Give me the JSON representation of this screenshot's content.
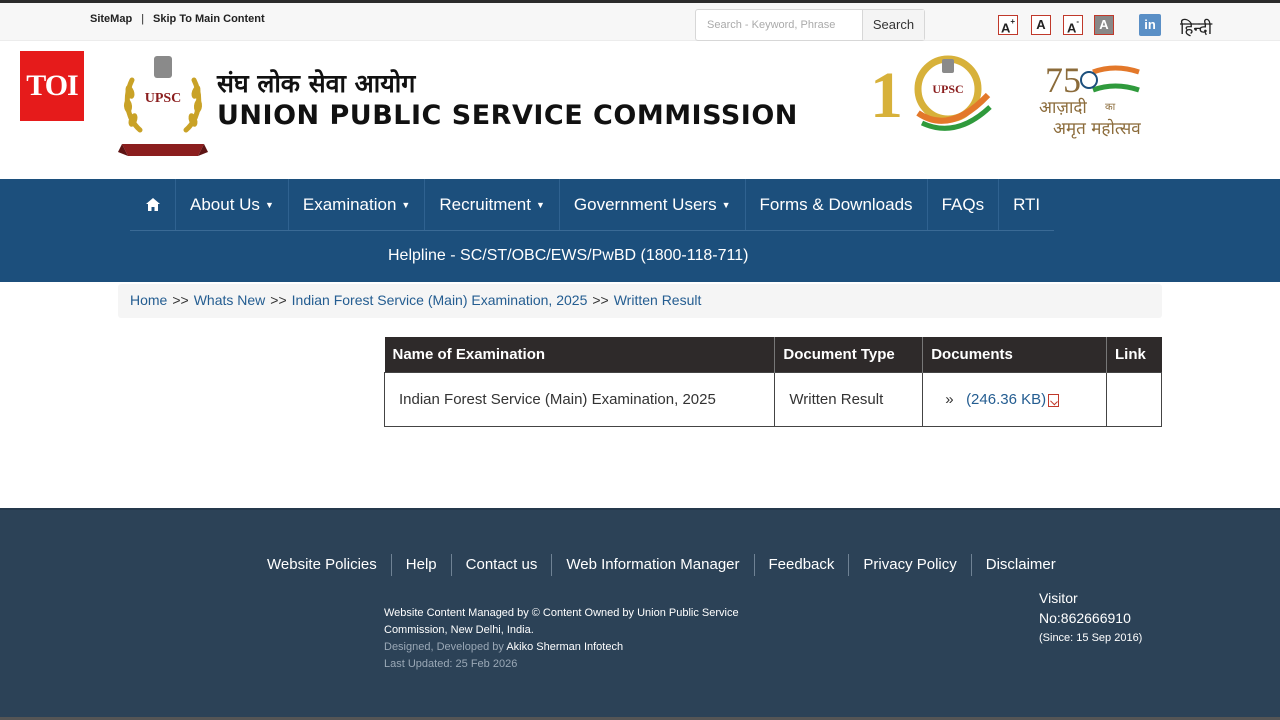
{
  "topbar": {
    "sitemap": "SiteMap",
    "separator": "|",
    "skip": "Skip To Main Content",
    "search_placeholder": "Search - Keyword, Phrase",
    "search_button": "Search",
    "font_sizes": [
      "A",
      "A",
      "A",
      "A"
    ],
    "linkedin": "in",
    "language": "हिन्दी"
  },
  "header": {
    "toi_logo": "TOI",
    "emblem_text": "UPSC",
    "hindi_title": "संघ लोक सेवा आयोग",
    "english_title": "UNION PUBLIC SERVICE COMMISSION",
    "logo100_text": "UPSC",
    "logo75_line1": "आज़ादी",
    "logo75_ka": "का",
    "logo75_line2": "अमृत महोत्सव"
  },
  "nav": {
    "items": [
      {
        "label": "About Us",
        "dropdown": true
      },
      {
        "label": "Examination",
        "dropdown": true
      },
      {
        "label": "Recruitment",
        "dropdown": true
      },
      {
        "label": "Government Users",
        "dropdown": true
      },
      {
        "label": "Forms & Downloads",
        "dropdown": false
      },
      {
        "label": "FAQs",
        "dropdown": false
      },
      {
        "label": "RTI",
        "dropdown": false
      }
    ],
    "helpline": "Helpline - SC/ST/OBC/EWS/PwBD (1800-118-711)"
  },
  "breadcrumb": {
    "items": [
      "Home",
      "Whats New",
      "Indian Forest Service (Main) Examination, 2025",
      "Written Result"
    ],
    "separator": ">>"
  },
  "table": {
    "headers": [
      "Name of Examination",
      "Document Type",
      "Documents",
      "Link"
    ],
    "rows": [
      {
        "name": "Indian Forest Service (Main) Examination, 2025",
        "type": "Written Result",
        "doc_prefix": "»",
        "doc_size": "(246.36 KB)",
        "link": ""
      }
    ]
  },
  "footer": {
    "links": [
      "Website Policies",
      "Help",
      "Contact us",
      "Web Information Manager",
      "Feedback",
      "Privacy Policy",
      "Disclaimer"
    ],
    "managed_line1": "Website Content Managed by © Content Owned by Union Public Service",
    "managed_line2": "Commission, New Delhi, India.",
    "designed_prefix": "Designed, Developed by",
    "designed_by": "Akiko Sherman Infotech",
    "last_updated": "Last Updated: 25 Feb 2026",
    "visitor_label": "Visitor",
    "visitor_no": "No:862666910",
    "visitor_since": "(Since: 15 Sep 2016)"
  },
  "colors": {
    "nav_bg": "#1c4f7c",
    "footer_bg": "#2c4257",
    "link": "#245d91",
    "toi_red": "#e61b1b"
  }
}
